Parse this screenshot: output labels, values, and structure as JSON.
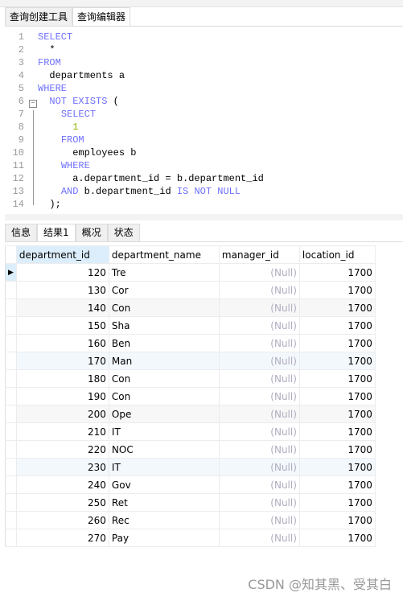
{
  "editor_tabs": [
    "查询创建工具",
    "查询编辑器"
  ],
  "sql_lines": [
    [
      {
        "t": "SELECT",
        "k": 1
      }
    ],
    [
      {
        "t": "  *"
      }
    ],
    [
      {
        "t": "FROM",
        "k": 1
      }
    ],
    [
      {
        "t": "  departments a"
      }
    ],
    [
      {
        "t": "WHERE",
        "k": 1
      }
    ],
    [
      {
        "t": "  "
      },
      {
        "t": "NOT EXISTS",
        "k": 1
      },
      {
        "t": " ("
      }
    ],
    [
      {
        "t": "    "
      },
      {
        "t": "SELECT",
        "k": 1
      }
    ],
    [
      {
        "t": "      "
      },
      {
        "t": "1",
        "n": 1
      }
    ],
    [
      {
        "t": "    "
      },
      {
        "t": "FROM",
        "k": 1
      }
    ],
    [
      {
        "t": "      employees b"
      }
    ],
    [
      {
        "t": "    "
      },
      {
        "t": "WHERE",
        "k": 1
      }
    ],
    [
      {
        "t": "      a.department_id = b.department_id"
      }
    ],
    [
      {
        "t": "    "
      },
      {
        "t": "AND",
        "k": 1
      },
      {
        "t": " b.department_id "
      },
      {
        "t": "IS NOT NULL",
        "k": 1
      }
    ],
    [
      {
        "t": "  );"
      }
    ]
  ],
  "result_tabs": [
    "信息",
    "结果1",
    "概况",
    "状态"
  ],
  "columns": [
    "department_id",
    "department_name",
    "manager_id",
    "location_id"
  ],
  "rows": [
    [
      "120",
      "Tre",
      "(Null)",
      "1700"
    ],
    [
      "130",
      "Cor",
      "(Null)",
      "1700"
    ],
    [
      "140",
      "Con",
      "(Null)",
      "1700"
    ],
    [
      "150",
      "Sha",
      "(Null)",
      "1700"
    ],
    [
      "160",
      "Ben",
      "(Null)",
      "1700"
    ],
    [
      "170",
      "Man",
      "(Null)",
      "1700"
    ],
    [
      "180",
      "Con",
      "(Null)",
      "1700"
    ],
    [
      "190",
      "Con",
      "(Null)",
      "1700"
    ],
    [
      "200",
      "Ope",
      "(Null)",
      "1700"
    ],
    [
      "210",
      "IT",
      "(Null)",
      "1700"
    ],
    [
      "220",
      "NOC",
      "(Null)",
      "1700"
    ],
    [
      "230",
      "IT",
      "(Null)",
      "1700"
    ],
    [
      "240",
      "Gov",
      "(Null)",
      "1700"
    ],
    [
      "250",
      "Ret",
      "(Null)",
      "1700"
    ],
    [
      "260",
      "Rec",
      "(Null)",
      "1700"
    ],
    [
      "270",
      "Pay",
      "(Null)",
      "1700"
    ]
  ],
  "watermark": "CSDN @知其黑、受其白"
}
